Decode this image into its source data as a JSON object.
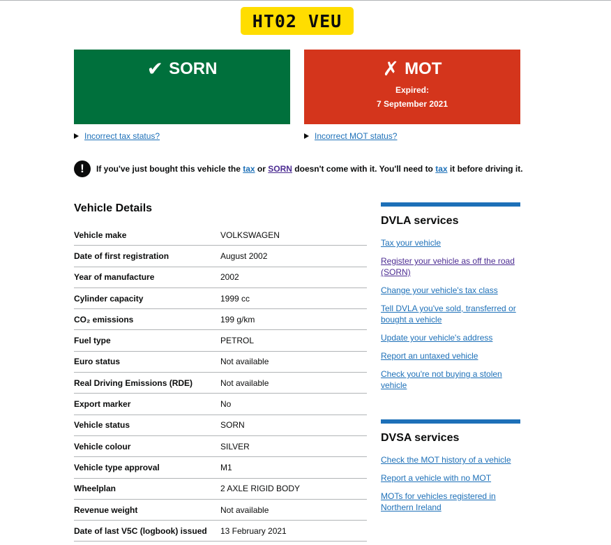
{
  "plate": "HT02 VEU",
  "tax": {
    "icon": "checkmark-icon",
    "status": "SORN",
    "color": "#00703c"
  },
  "mot": {
    "icon": "cross-icon",
    "status": "MOT",
    "expired_label": "Expired:",
    "expired_date": "7 September 2021",
    "color": "#d4351c"
  },
  "links": {
    "incorrect_tax": "Incorrect tax status?",
    "incorrect_mot": "Incorrect MOT status?"
  },
  "warning": {
    "part1": "If you've just bought this vehicle the",
    "tax_link": "tax",
    "or": "or",
    "sorn_link": "SORN",
    "part2": "doesn't come with it. You'll need to",
    "tax_link2": "tax",
    "part3": "it before driving it."
  },
  "details": {
    "heading": "Vehicle Details",
    "rows": [
      {
        "key": "Vehicle make",
        "value": "VOLKSWAGEN"
      },
      {
        "key": "Date of first registration",
        "value": "August 2002"
      },
      {
        "key": "Year of manufacture",
        "value": "2002"
      },
      {
        "key": "Cylinder capacity",
        "value": "1999 cc"
      },
      {
        "key": "CO₂ emissions",
        "value": "199 g/km"
      },
      {
        "key": "Fuel type",
        "value": "PETROL"
      },
      {
        "key": "Euro status",
        "value": "Not available"
      },
      {
        "key": "Real Driving Emissions (RDE)",
        "value": "Not available"
      },
      {
        "key": "Export marker",
        "value": "No"
      },
      {
        "key": "Vehicle status",
        "value": "SORN"
      },
      {
        "key": "Vehicle colour",
        "value": "SILVER"
      },
      {
        "key": "Vehicle type approval",
        "value": "M1"
      },
      {
        "key": "Wheelplan",
        "value": "2 AXLE RIGID BODY"
      },
      {
        "key": "Revenue weight",
        "value": "Not available"
      },
      {
        "key": "Date of last V5C (logbook) issued",
        "value": "13 February 2021"
      }
    ]
  },
  "dvla": {
    "heading": "DVLA services",
    "items": [
      "Tax your vehicle",
      "Register your vehicle as off the road (SORN)",
      "Change your vehicle's tax class",
      "Tell DVLA you've sold, transferred or bought a vehicle",
      "Update your vehicle's address",
      "Report an untaxed vehicle",
      "Check you're not buying a stolen vehicle"
    ]
  },
  "dvsa": {
    "heading": "DVSA services",
    "items": [
      "Check the MOT history of a vehicle",
      "Report a vehicle with no MOT",
      "MOTs for vehicles registered in Northern Ireland"
    ]
  }
}
